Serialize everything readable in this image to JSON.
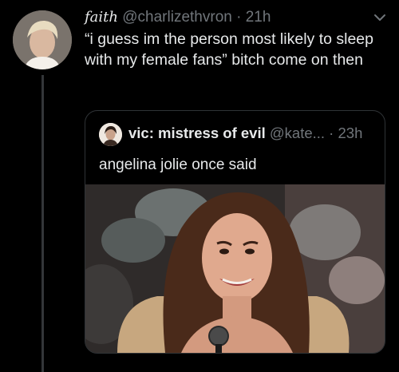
{
  "tweet": {
    "author_name": "faith",
    "handle": "@charlizethvron",
    "separator": " · ",
    "time": "21h",
    "text": "“i guess im the person most likely to sleep with my female fans” bitch come on then"
  },
  "quoted_tweet": {
    "author_name": "vic: mistress of evil",
    "handle": "@kate...",
    "separator": " · ",
    "time": "23h",
    "text": "angelina jolie once said",
    "image_icon": "photo-of-woman-at-microphone"
  },
  "icons": {
    "menu": "chevron-down-icon"
  },
  "colors": {
    "background": "#000000",
    "primary_text": "#e7e9ea",
    "secondary_text": "#71767b",
    "border": "#2f3336"
  }
}
